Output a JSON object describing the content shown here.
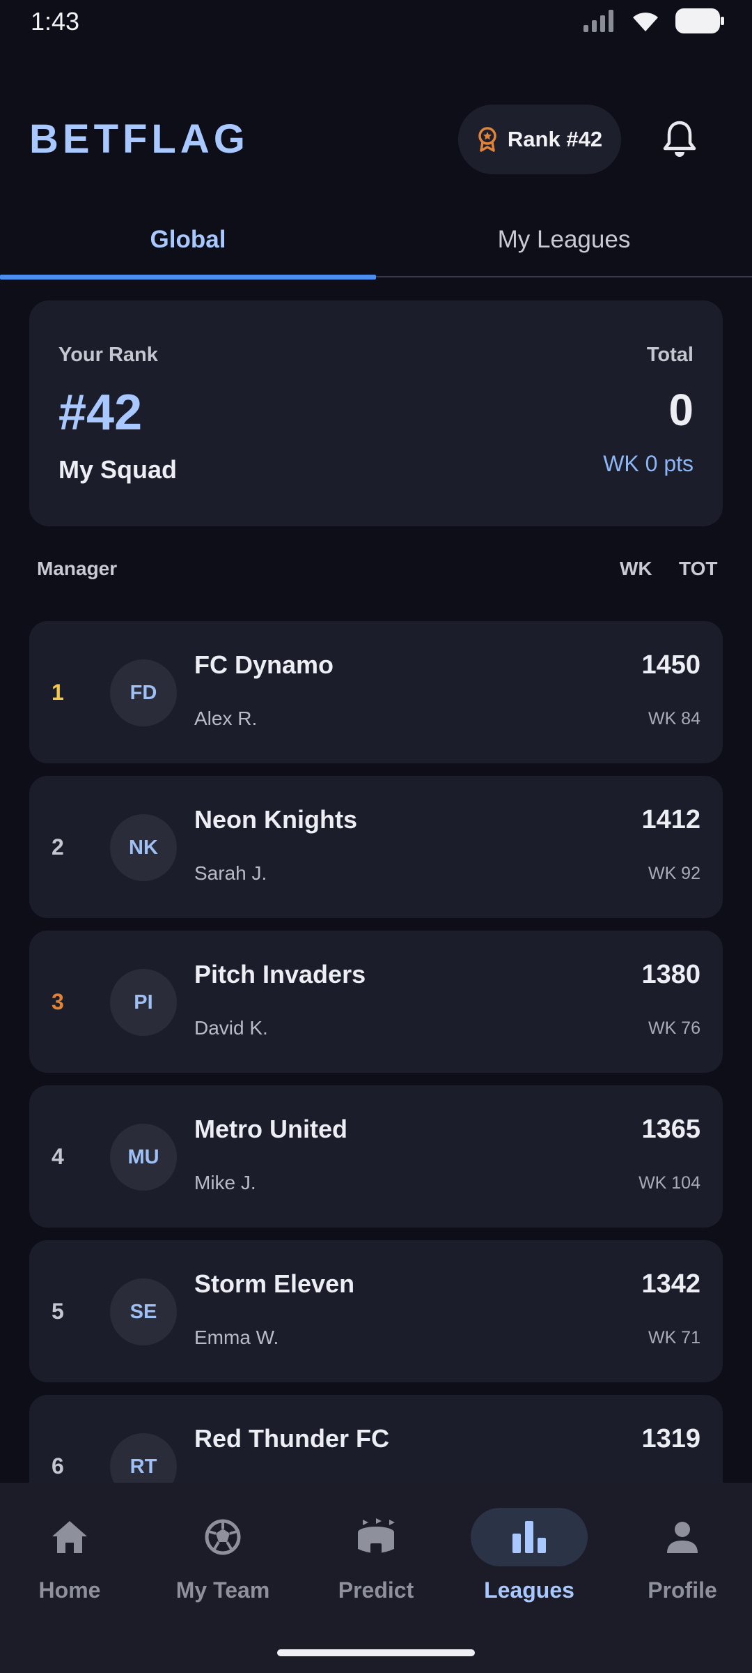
{
  "status_bar": {
    "time": "1:43"
  },
  "header": {
    "brand": "BETFLAG",
    "rank_pill": "Rank #42"
  },
  "tabs": [
    {
      "label": "Global",
      "active": true
    },
    {
      "label": "My Leagues",
      "active": false
    }
  ],
  "rank_card": {
    "your_rank_label": "Your Rank",
    "rank_value": "#42",
    "squad_name": "My Squad",
    "total_label": "Total",
    "total_value": "0",
    "week_points": "WK 0 pts"
  },
  "columns": {
    "manager": "Manager",
    "wk": "WK",
    "tot": "TOT"
  },
  "leaderboard": [
    {
      "pos": "1",
      "initials": "FD",
      "team": "FC Dynamo",
      "manager": "Alex R.",
      "total": "1450",
      "wk": "WK 84",
      "pos_color": "#f2c94c"
    },
    {
      "pos": "2",
      "initials": "NK",
      "team": "Neon Knights",
      "manager": "Sarah J.",
      "total": "1412",
      "wk": "WK 92",
      "pos_color": "#c4c6d0"
    },
    {
      "pos": "3",
      "initials": "PI",
      "team": "Pitch Invaders",
      "manager": "David K.",
      "total": "1380",
      "wk": "WK 76",
      "pos_color": "#e0843a"
    },
    {
      "pos": "4",
      "initials": "MU",
      "team": "Metro United",
      "manager": "Mike J.",
      "total": "1365",
      "wk": "WK 104",
      "pos_color": "#c4c6d0"
    },
    {
      "pos": "5",
      "initials": "SE",
      "team": "Storm Eleven",
      "manager": "Emma W.",
      "total": "1342",
      "wk": "WK 71",
      "pos_color": "#c4c6d0"
    },
    {
      "pos": "6",
      "initials": "RT",
      "team": "Red Thunder FC",
      "manager": "",
      "total": "1319",
      "wk": "",
      "pos_color": "#c4c6d0"
    }
  ],
  "bottom_nav": [
    {
      "label": "Home",
      "icon": "home-icon",
      "active": false
    },
    {
      "label": "My Team",
      "icon": "soccer-ball-icon",
      "active": false
    },
    {
      "label": "Predict",
      "icon": "stadium-icon",
      "active": false
    },
    {
      "label": "Leagues",
      "icon": "bar-chart-icon",
      "active": true
    },
    {
      "label": "Profile",
      "icon": "person-icon",
      "active": false
    }
  ],
  "colors": {
    "accent": "#a9c8ff",
    "tab_indicator": "#4b8eef",
    "background": "#0d0e17",
    "card": "#1c1d2a",
    "gold": "#f2c94c",
    "bronze": "#e0843a"
  }
}
